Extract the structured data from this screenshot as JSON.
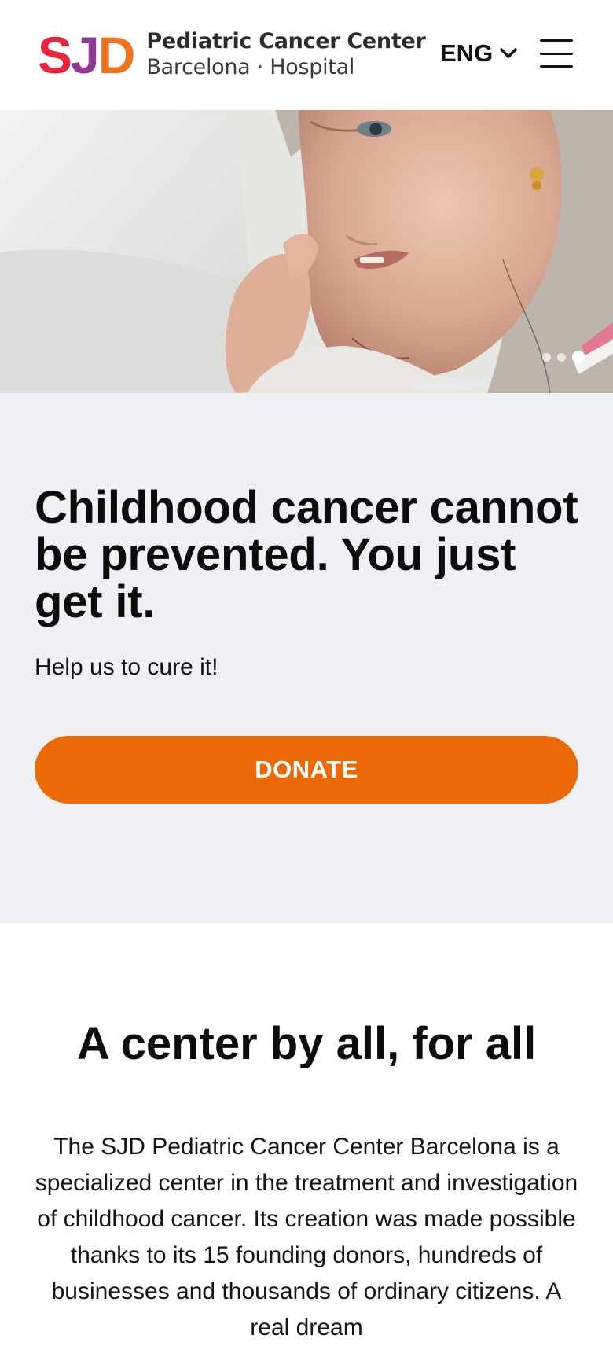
{
  "header": {
    "logo": {
      "letters": [
        "S",
        "J",
        "D"
      ],
      "letter_colors": [
        "#e8253c",
        "#8f3a96",
        "#f2711c"
      ],
      "line1": "Pediatric Cancer Center",
      "line2": "Barcelona · Hospital"
    },
    "language": {
      "label": "ENG",
      "icon": "chevron-down-icon"
    },
    "menu": {
      "icon": "hamburger-menu-icon"
    }
  },
  "hero": {
    "image": "photo of a young girl patient in a hospital bed",
    "slides": {
      "count": 3,
      "active_index": 2
    }
  },
  "campaign": {
    "headline": "Childhood cancer cannot be prevented. You just get it.",
    "subtitle": "Help us to cure it!",
    "donate_label": "DONATE"
  },
  "about": {
    "title": "A center by all, for all",
    "body": "The SJD Pediatric Cancer Center Barcelona is a specialized center in the treatment and investigation of childhood cancer. Its creation was made possible thanks to its 15 founding donors, hundreds of businesses and thousands of ordinary citizens. A real dream"
  },
  "colors": {
    "accent": "#eb6a06",
    "campaign_bg": "#eff1f5",
    "text": "#111111"
  }
}
